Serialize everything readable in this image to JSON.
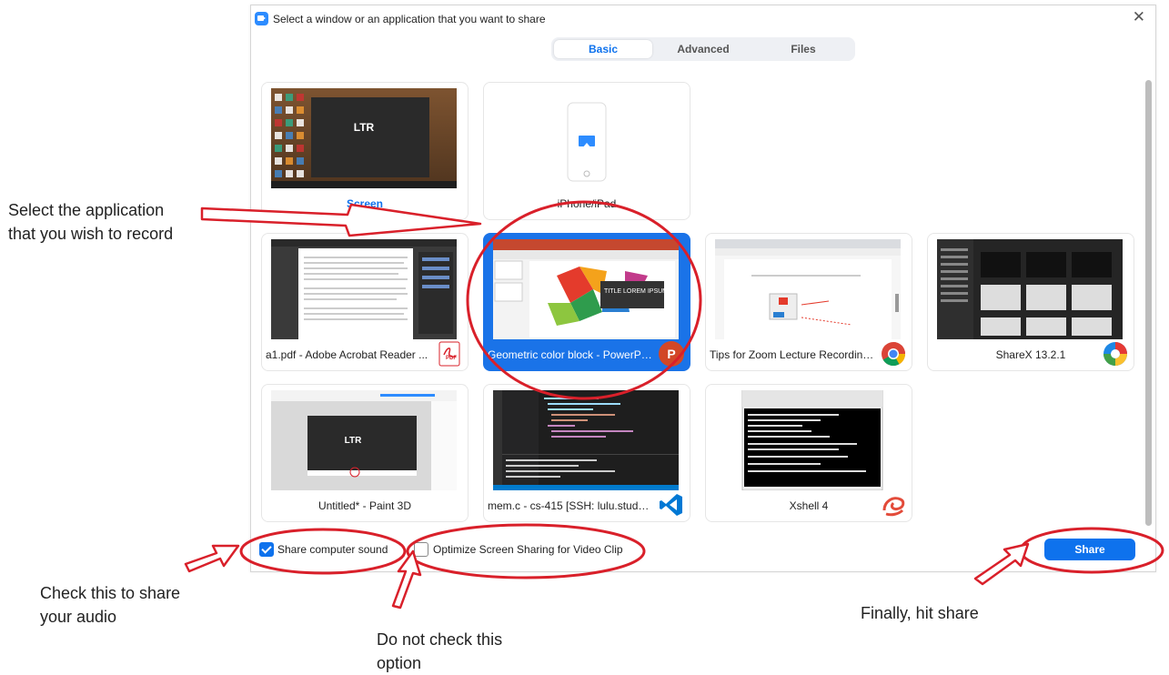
{
  "dialog": {
    "title": "Select a window or an application that you want to share",
    "tabs": [
      {
        "label": "Basic",
        "active": true
      },
      {
        "label": "Advanced",
        "active": false
      },
      {
        "label": "Files",
        "active": false
      }
    ]
  },
  "tiles": {
    "screen": {
      "label": "Screen",
      "thumb_text": "LTR"
    },
    "iphone": {
      "label": "iPhone/iPad"
    },
    "acrobat": {
      "label": "a1.pdf - Adobe Acrobat Reader ...",
      "badge_text": "PDF"
    },
    "powerpoint": {
      "label": "Geometric color block - PowerPoi...",
      "badge_text": "P",
      "thumb_title": "TITLE LOREM IPSUM"
    },
    "chrome": {
      "label": "Tips for Zoom Lecture Recording...."
    },
    "sharex": {
      "label": "ShareX 13.2.1"
    },
    "paint3d": {
      "label": "Untitled* - Paint 3D",
      "thumb_text": "LTR"
    },
    "vscode": {
      "label": "mem.c - cs-415 [SSH: lulu.student..."
    },
    "xshell": {
      "label": "Xshell 4"
    }
  },
  "bottom": {
    "share_sound_label": "Share computer sound",
    "optimize_label": "Optimize Screen Sharing for Video Clip",
    "share_button": "Share"
  },
  "annotations": {
    "select_app": "Select the application\nthat you wish to record",
    "audio": "Check this to share\nyour audio",
    "dont_check": "Do not check this\noption",
    "finally": "Finally, hit share"
  },
  "colors": {
    "accent": "#0e72ed",
    "annotation_red": "#d9202a",
    "selected_tile": "#1a73e8"
  }
}
